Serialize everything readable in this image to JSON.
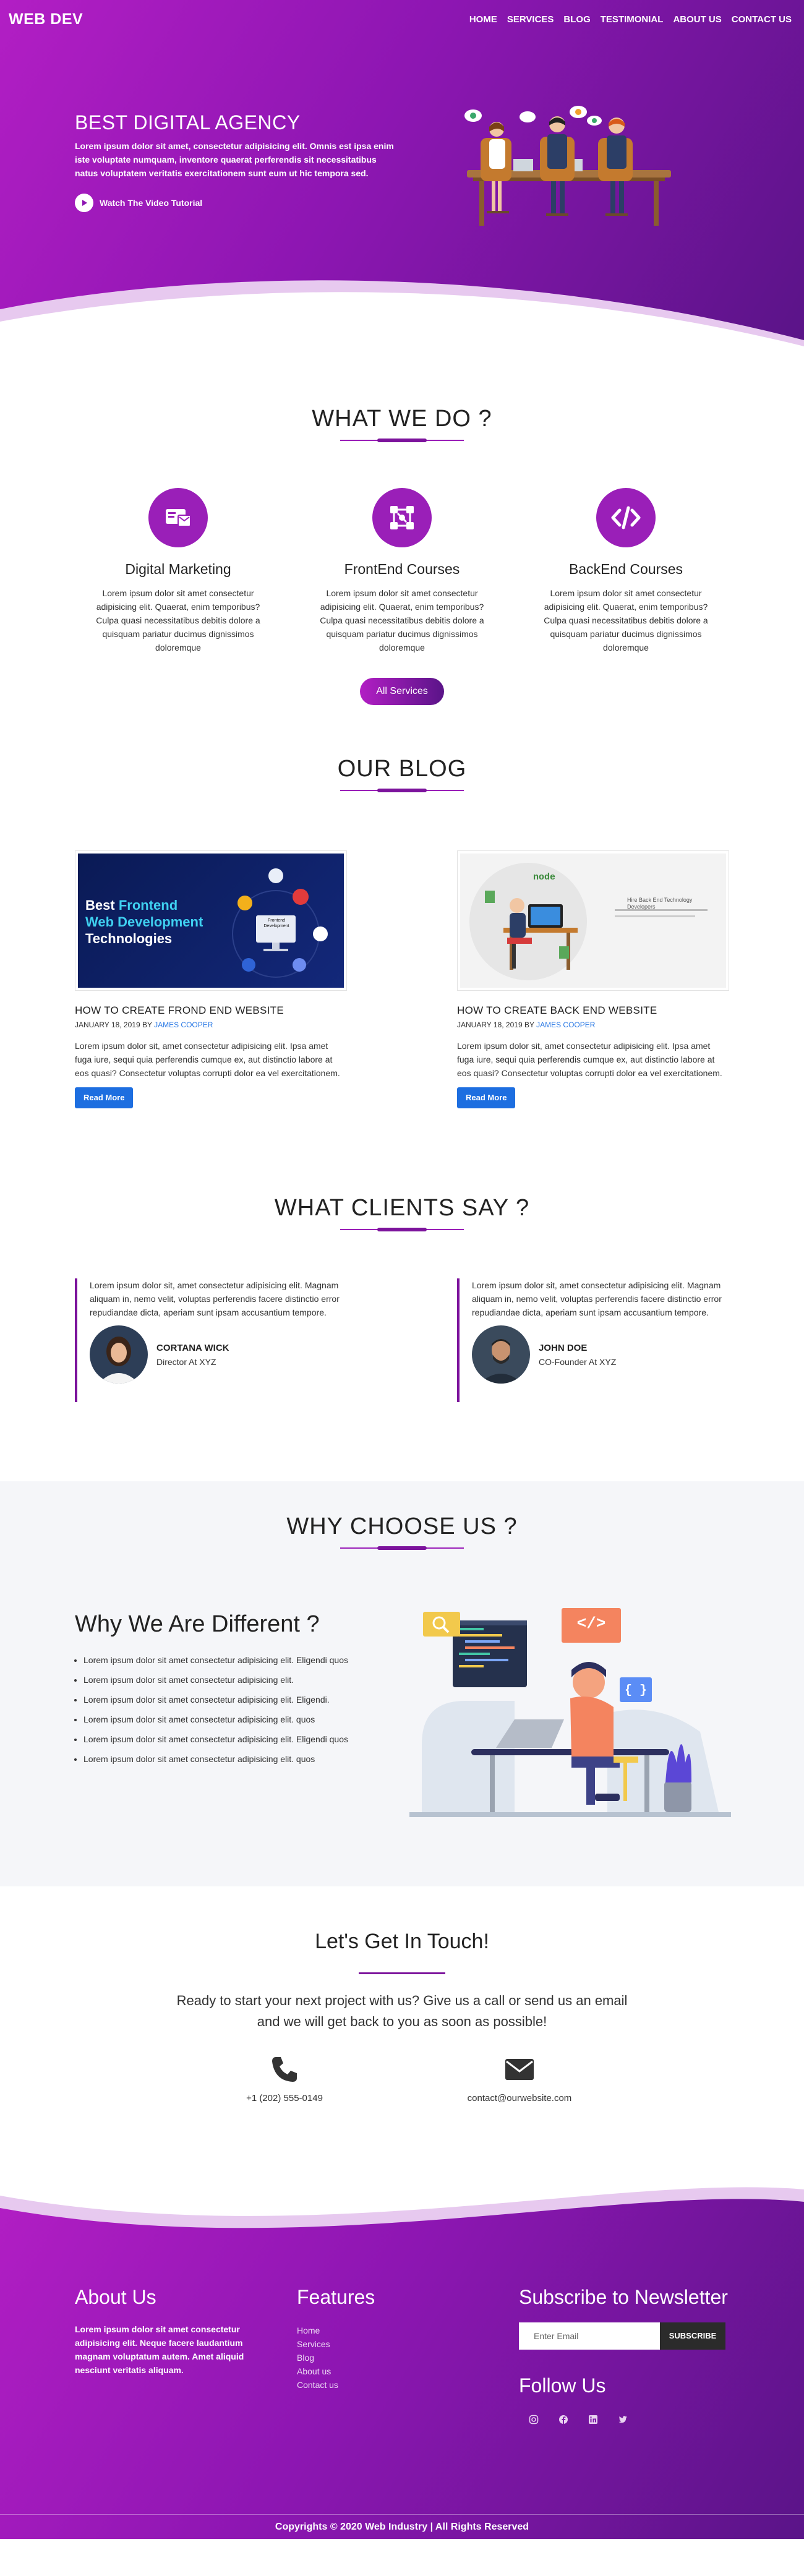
{
  "header": {
    "logo": "WEB DEV",
    "menu": [
      "HOME",
      "SERVICES",
      "BLOG",
      "TESTIMONIAL",
      "ABOUT US",
      "CONTACT US"
    ]
  },
  "hero": {
    "title": "BEST DIGITAL AGENCY",
    "text": "Lorem ipsum dolor sit amet, consectetur adipisicing elit. Omnis est ipsa enim iste voluptate numquam, inventore quaerat perferendis sit necessitatibus natus voluptatem veritatis exercitationem sunt eum ut hic tempora sed.",
    "video_label": "Watch The Video Tutorial"
  },
  "services": {
    "title": "WHAT WE DO ?",
    "items": [
      {
        "title": "Digital Marketing",
        "text": "Lorem ipsum dolor sit amet consectetur adipisicing elit. Quaerat, enim temporibus? Culpa quasi necessitatibus debitis dolore a quisquam pariatur ducimus dignissimos doloremque",
        "icon": "marketing-icon"
      },
      {
        "title": "FrontEnd Courses",
        "text": "Lorem ipsum dolor sit amet consectetur adipisicing elit. Quaerat, enim temporibus? Culpa quasi necessitatibus debitis dolore a quisquam pariatur ducimus dignissimos doloremque",
        "icon": "network-icon"
      },
      {
        "title": "BackEnd Courses",
        "text": "Lorem ipsum dolor sit amet consectetur adipisicing elit. Quaerat, enim temporibus? Culpa quasi necessitatibus debitis dolore a quisquam pariatur ducimus dignissimos doloremque",
        "icon": "code-icon"
      }
    ],
    "button": "All Services"
  },
  "blog": {
    "title": "OUR BLOG",
    "posts": [
      {
        "title": "HOW TO CREATE FROND END WEBSITE",
        "date": "JANUARY 18, 2019 BY",
        "author": "JAMES COOPER",
        "text": "Lorem ipsum dolor sit, amet consectetur adipisicing elit. Ipsa amet fuga iure, sequi quia perferendis cumque ex, aut distinctio labore at eos quasi? Consectetur voluptas corrupti dolor ea vel exercitationem.",
        "button": "Read More",
        "image_line1": "Best",
        "image_word_accent": "Frontend",
        "image_line2": "Web Development",
        "image_line3": "Technologies",
        "image_badge": "Frontend Development"
      },
      {
        "title": "HOW TO CREATE BACK END WEBSITE",
        "date": "JANUARY 18, 2019 BY",
        "author": "JAMES COOPER",
        "text": "Lorem ipsum dolor sit, amet consectetur adipisicing elit. Ipsa amet fuga iure, sequi quia perferendis cumque ex, aut distinctio labore at eos quasi? Consectetur voluptas corrupti dolor ea vel exercitationem.",
        "button": "Read More",
        "image_logo": "node",
        "image_heading": "Hire Back End Technology Developers"
      }
    ]
  },
  "testimonials": {
    "title": "WHAT CLIENTS SAY ?",
    "items": [
      {
        "text": "Lorem ipsum dolor sit, amet consectetur adipisicing elit. Magnam aliquam in, nemo velit, voluptas perferendis facere distinctio error repudiandae dicta, aperiam sunt ipsam accusantium tempore.",
        "name": "CORTANA WICK",
        "role": "Director At XYZ"
      },
      {
        "text": "Lorem ipsum dolor sit, amet consectetur adipisicing elit. Magnam aliquam in, nemo velit, voluptas perferendis facere distinctio error repudiandae dicta, aperiam sunt ipsam accusantium tempore.",
        "name": "JOHN DOE",
        "role": "CO-Founder At XYZ"
      }
    ]
  },
  "why": {
    "title": "WHY CHOOSE US ?",
    "heading": "Why We Are Different ?",
    "points": [
      "Lorem ipsum dolor sit amet consectetur adipisicing elit. Eligendi quos",
      "Lorem ipsum dolor sit amet consectetur adipisicing elit.",
      "Lorem ipsum dolor sit amet consectetur adipisicing elit. Eligendi.",
      "Lorem ipsum dolor sit amet consectetur adipisicing elit. quos",
      "Lorem ipsum dolor sit amet consectetur adipisicing elit. Eligendi quos",
      "Lorem ipsum dolor sit amet consectetur adipisicing elit. quos"
    ],
    "illus_code_tag": "</>",
    "illus_brace_tag": "{ }"
  },
  "contact": {
    "title": "Let's Get In Touch!",
    "text": "Ready to start your next project with us? Give us a call or send us an email and we will get back to you as soon as possible!",
    "phone": "+1 (202) 555-0149",
    "email": "contact@ourwebsite.com"
  },
  "footer": {
    "about_title": "About Us",
    "about_text": "Lorem ipsum dolor sit amet consectetur adipisicing elit. Neque facere laudantium magnam voluptatum autem. Amet aliquid nesciunt veritatis aliquam.",
    "features_title": "Features",
    "features": [
      "Home",
      "Services",
      "Blog",
      "About us",
      "Contact us"
    ],
    "newsletter_title": "Subscribe to Newsletter",
    "email_placeholder": "Enter Email",
    "subscribe_button": "SUBSCRIBE",
    "follow_title": "Follow Us",
    "socials": [
      "instagram-icon",
      "facebook-icon",
      "linkedin-icon",
      "twitter-icon"
    ],
    "copyright": "Copyrights © 2020 Web Industry | All Rights Reserved"
  },
  "colors": {
    "primary": "#9a1fb8",
    "gradient_start": "#b21ec4",
    "gradient_end": "#5a1488",
    "button_blue": "#1d6ee0",
    "link_blue": "#2d7be5",
    "section_bg": "#f5f6f9"
  }
}
